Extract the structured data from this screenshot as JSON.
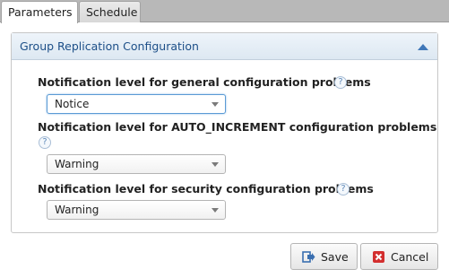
{
  "tabs": [
    {
      "label": "Parameters",
      "active": true
    },
    {
      "label": "Schedule",
      "active": false
    }
  ],
  "panel": {
    "title": "Group Replication Configuration",
    "collapse_icon": "chevron-up-icon"
  },
  "fields": [
    {
      "label": "Notification level for general configuration problems",
      "help": "?",
      "value": "Notice"
    },
    {
      "label": "Notification level for AUTO_INCREMENT configuration problems",
      "help": "?",
      "value": "Warning"
    },
    {
      "label": "Notification level for security configuration problems",
      "help": "?",
      "value": "Warning"
    }
  ],
  "buttons": {
    "save": {
      "label": "Save",
      "icon": "save-icon"
    },
    "cancel": {
      "label": "Cancel",
      "icon": "cancel-icon"
    }
  },
  "colors": {
    "accent": "#1d4f88",
    "cancel_red": "#d32f2f",
    "save_blue": "#3a6fb0"
  }
}
